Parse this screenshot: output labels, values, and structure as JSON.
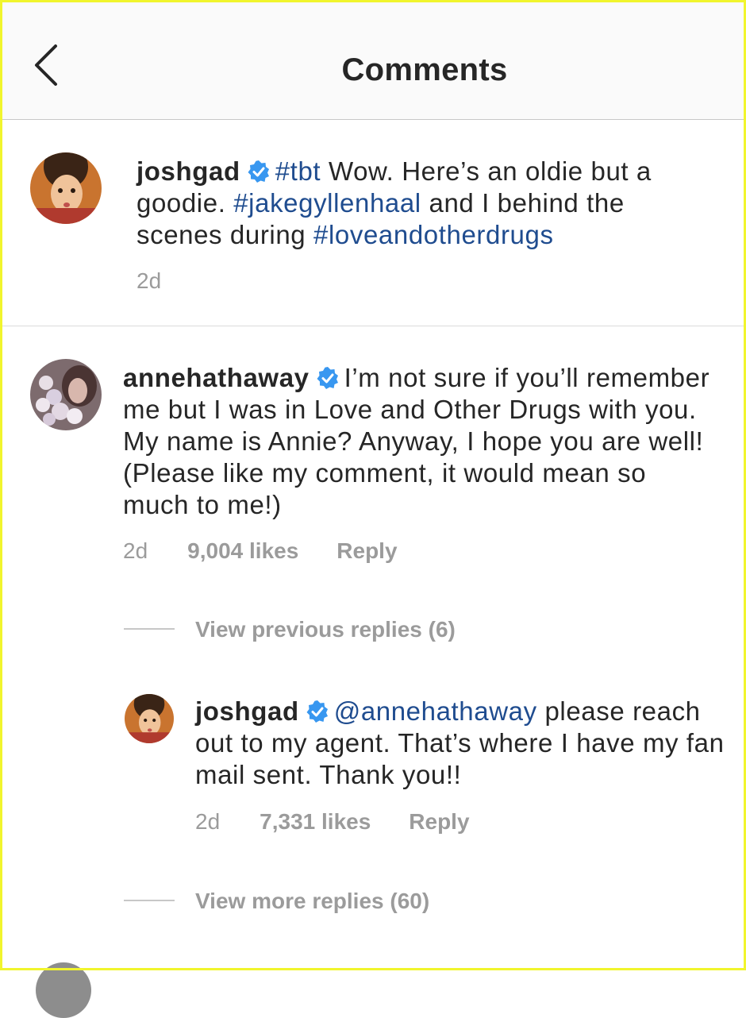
{
  "header": {
    "title": "Comments",
    "back_icon": "chevron-left-icon"
  },
  "caption": {
    "username": "joshgad",
    "segments": [
      {
        "type": "tag",
        "text": "#tbt"
      },
      {
        "type": "text",
        "text": " Wow. Here’s an oldie but a goodie. "
      },
      {
        "type": "tag",
        "text": "#jakegyllenhaal"
      },
      {
        "type": "text",
        "text": " and I behind the scenes during "
      },
      {
        "type": "tag",
        "text": "#loveandotherdrugs"
      }
    ],
    "time": "2d"
  },
  "comment": {
    "username": "annehathaway",
    "text": "I’m not sure if you’ll remember me but I was in Love and Other Drugs with you. My name is Annie? Anyway, I hope you are well! (Please like my comment, it would mean so much to me!)",
    "time": "2d",
    "likes": "9,004 likes",
    "reply": "Reply",
    "view_previous": "View previous replies (6)"
  },
  "reply": {
    "username": "joshgad",
    "mention": "@annehathaway",
    "text": " please reach out to my agent. That’s where I have my fan mail sent. Thank you!!",
    "time": "2d",
    "likes": "7,331 likes",
    "reply": "Reply",
    "view_more": "View more replies (60)"
  },
  "colors": {
    "link": "#1f4c8f",
    "verified": "#3897f0",
    "muted": "#9b9b9b",
    "frame": "#f1f52d"
  }
}
